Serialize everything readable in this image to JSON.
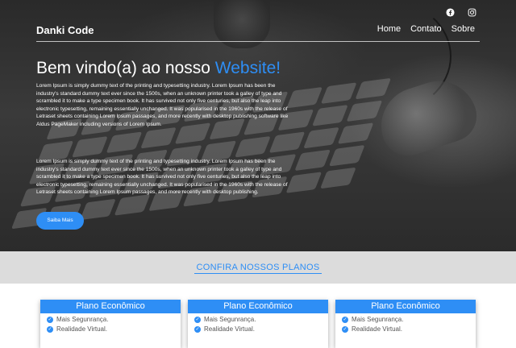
{
  "header": {
    "logo": "Danki Code",
    "nav": [
      "Home",
      "Contato",
      "Sobre"
    ],
    "social_icons": [
      "facebook-icon",
      "instagram-icon"
    ]
  },
  "hero": {
    "title_prefix": "Bem vindo(a) ao nosso ",
    "title_accent": "Website!",
    "paragraph1": "Lorem Ipsum is simply dummy text of the printing and typesetting industry. Lorem Ipsum has been the industry's standard dummy text ever since the 1500s, when an unknown printer took a galley of type and scrambled it to make a type specimen book. It has survived not only five centuries, but also the leap into electronic typesetting, remaining essentially unchanged. It was popularised in the 1960s with the release of Letraset sheets containing Lorem Ipsum passages, and more recently with desktop publishing software like Aldus PageMaker including versions of Lorem Ipsum.",
    "paragraph2": "Lorem Ipsum is simply dummy text of the printing and typesetting industry. Lorem Ipsum has been the industry's standard dummy text ever since the 1500s, when an unknown printer took a galley of type and scrambled it to make a type specimen book. It has survived not only five centuries, but also the leap into electronic typesetting, remaining essentially unchanged. It was popularised in the 1960s with the release of Letraset sheets containing Lorem Ipsum passages, and more recently with desktop publishing.",
    "cta": "Saiba Mais",
    "accent_color": "#2e8ef5"
  },
  "plans": {
    "section_title": "CONFIRA NOSSOS PLANOS",
    "cards": [
      {
        "title": "Plano Econômico",
        "features": [
          "Mais Segunrança.",
          "Realidade Virtual."
        ]
      },
      {
        "title": "Plano Econômico",
        "features": [
          "Mais Segunrança.",
          "Realidade Virtual."
        ]
      },
      {
        "title": "Plano Econômico",
        "features": [
          "Mais Segunrança.",
          "Realidade Virtual."
        ]
      }
    ]
  }
}
